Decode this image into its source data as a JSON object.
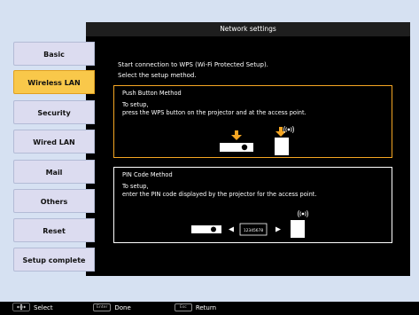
{
  "header": {
    "title": "Network settings"
  },
  "sidebar": {
    "items": [
      {
        "label": "Basic"
      },
      {
        "label": "Wireless LAN",
        "active": true
      },
      {
        "label": "Security"
      },
      {
        "label": "Wired LAN"
      },
      {
        "label": "Mail"
      },
      {
        "label": "Others"
      },
      {
        "label": "Reset"
      },
      {
        "label": "Setup complete"
      }
    ]
  },
  "main": {
    "intro_line1": "Start connection to WPS (Wi-Fi Protected Setup).",
    "intro_line2": "Select the setup method.",
    "push_button": {
      "title": "Push Button Method",
      "line1": "To setup,",
      "line2": "press the WPS button on the projector and at the access point."
    },
    "pin_code": {
      "title": "PIN Code Method",
      "line1": "To setup,",
      "line2": "enter the PIN code displayed by the projector for the access point.",
      "pin_display": "12345678"
    }
  },
  "footer": {
    "select_label": "Select",
    "enter_key": "Enter",
    "done_label": "Done",
    "esc_key": "Esc",
    "return_label": "Return"
  },
  "colors": {
    "accent": "#f5a623",
    "active_tab": "#f9c84a",
    "background": "#d6e1f2"
  },
  "icons": [
    "move-arrows-icon",
    "arrow-down-icon",
    "wireless-signal-icon",
    "projector-icon",
    "access-point-icon"
  ]
}
